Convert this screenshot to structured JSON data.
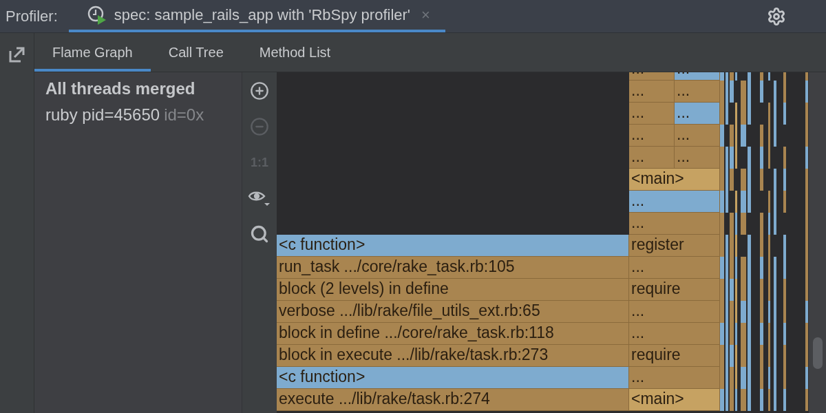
{
  "header": {
    "label": "Profiler:",
    "tab": {
      "title": "spec: sample_rails_app with 'RbSpy profiler'",
      "selected": true,
      "close": "×"
    }
  },
  "view_tabs": [
    {
      "label": "Flame Graph",
      "selected": true
    },
    {
      "label": "Call Tree",
      "selected": false
    },
    {
      "label": "Method List",
      "selected": false
    }
  ],
  "threads": {
    "title": "All threads merged",
    "items": [
      {
        "name": "ruby pid=45650",
        "id": "id=0x",
        "selected": false
      }
    ]
  },
  "toolbar": [
    {
      "kind": "zoom-in",
      "disabled": false
    },
    {
      "kind": "zoom-out",
      "disabled": true
    },
    {
      "kind": "actual-size",
      "label": "1:1",
      "disabled": true
    },
    {
      "kind": "view",
      "disabled": false
    },
    {
      "kind": "search",
      "disabled": false
    }
  ],
  "flame_graph": {
    "rows": [
      {
        "indented": true,
        "frames": [
          {
            "label": "...",
            "kind": "ruby"
          },
          {
            "label": "...",
            "kind": "native"
          }
        ]
      },
      {
        "indented": true,
        "frames": [
          {
            "label": "...",
            "kind": "ruby"
          },
          {
            "label": "...",
            "kind": "ruby"
          }
        ]
      },
      {
        "indented": true,
        "frames": [
          {
            "label": "...",
            "kind": "ruby"
          },
          {
            "label": "...",
            "kind": "native"
          }
        ]
      },
      {
        "indented": true,
        "frames": [
          {
            "label": "...",
            "kind": "ruby"
          },
          {
            "label": "...",
            "kind": "ruby"
          }
        ]
      },
      {
        "indented": true,
        "frames": [
          {
            "label": "...",
            "kind": "ruby"
          },
          {
            "label": "...",
            "kind": "ruby"
          }
        ]
      },
      {
        "indented": true,
        "frames": [
          {
            "label": "<main>",
            "kind": "main"
          }
        ]
      },
      {
        "indented": true,
        "frames": [
          {
            "label": "...",
            "kind": "native"
          }
        ]
      },
      {
        "indented": true,
        "frames": [
          {
            "label": "...",
            "kind": "ruby"
          }
        ]
      },
      {
        "indented": false,
        "frames": [
          {
            "label": "<c function>",
            "kind": "native"
          },
          {
            "label": "register",
            "kind": "ruby"
          }
        ]
      },
      {
        "indented": false,
        "frames": [
          {
            "label": "run_task .../core/rake_task.rb:105",
            "kind": "ruby"
          },
          {
            "label": "...",
            "kind": "ruby"
          }
        ]
      },
      {
        "indented": false,
        "frames": [
          {
            "label": "block (2 levels) in define",
            "kind": "ruby"
          },
          {
            "label": "require",
            "kind": "ruby"
          }
        ]
      },
      {
        "indented": false,
        "frames": [
          {
            "label": "verbose .../lib/rake/file_utils_ext.rb:65",
            "kind": "ruby"
          },
          {
            "label": "...",
            "kind": "ruby"
          }
        ]
      },
      {
        "indented": false,
        "frames": [
          {
            "label": "block in define .../core/rake_task.rb:118",
            "kind": "ruby"
          },
          {
            "label": "...",
            "kind": "ruby"
          }
        ]
      },
      {
        "indented": false,
        "frames": [
          {
            "label": "block in execute .../lib/rake/task.rb:273",
            "kind": "ruby"
          },
          {
            "label": "require",
            "kind": "ruby"
          }
        ]
      },
      {
        "indented": false,
        "frames": [
          {
            "label": "<c function>",
            "kind": "native"
          },
          {
            "label": "...",
            "kind": "ruby"
          }
        ]
      },
      {
        "indented": false,
        "frames": [
          {
            "label": "execute .../lib/rake/task.rb:274",
            "kind": "ruby"
          },
          {
            "label": "<main>",
            "kind": "main"
          }
        ]
      }
    ]
  }
}
